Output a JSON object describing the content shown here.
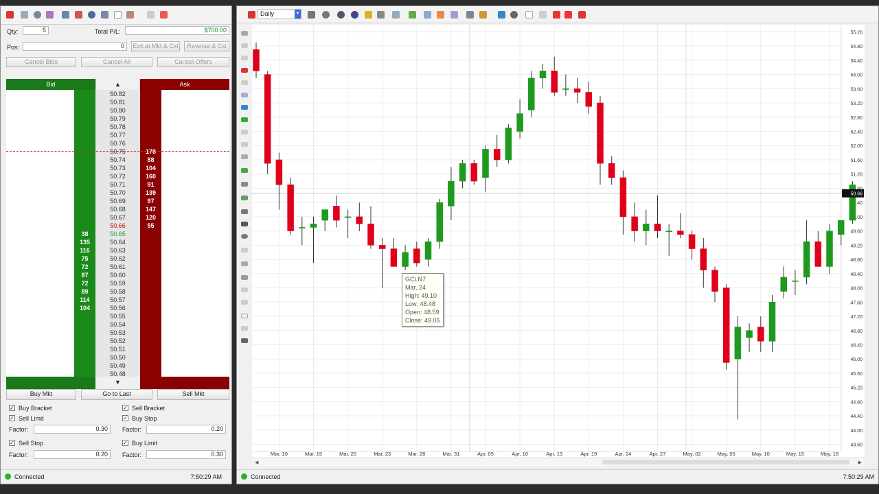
{
  "order_panel": {
    "qty_label": "Qty:",
    "qty_value": "5",
    "total_pl_label": "Total P/L:",
    "total_pl_value": "$700.00",
    "pos_label": "Pos:",
    "pos_value": "0",
    "exit_label": "Exit at Mkt & Cxl",
    "reverse_label": "Reverse & Cxl",
    "cancel_bids_label": "Cancel Bids",
    "cancel_all_label": "Cancel All",
    "cancel_offers_label": "Cancel Offers"
  },
  "ladder": {
    "bid_header": "Bid",
    "ask_header": "Ask",
    "last_price": "50.66",
    "rows": [
      {
        "price": "50.82",
        "bid": "",
        "ask": ""
      },
      {
        "price": "50.81",
        "bid": "",
        "ask": ""
      },
      {
        "price": "50.80",
        "bid": "",
        "ask": ""
      },
      {
        "price": "50.79",
        "bid": "",
        "ask": ""
      },
      {
        "price": "50.78",
        "bid": "",
        "ask": ""
      },
      {
        "price": "50.77",
        "bid": "",
        "ask": ""
      },
      {
        "price": "50.76",
        "bid": "",
        "ask": ""
      },
      {
        "price": "50.75",
        "bid": "",
        "ask": "178"
      },
      {
        "price": "50.74",
        "bid": "",
        "ask": "88"
      },
      {
        "price": "50.73",
        "bid": "",
        "ask": "104"
      },
      {
        "price": "50.72",
        "bid": "",
        "ask": "160"
      },
      {
        "price": "50.71",
        "bid": "",
        "ask": "91"
      },
      {
        "price": "50.70",
        "bid": "",
        "ask": "139"
      },
      {
        "price": "50.69",
        "bid": "",
        "ask": "97"
      },
      {
        "price": "50.68",
        "bid": "",
        "ask": "147"
      },
      {
        "price": "50.67",
        "bid": "",
        "ask": "120"
      },
      {
        "price": "50.66",
        "bid": "",
        "ask": "55"
      },
      {
        "price": "50.65",
        "bid": "38",
        "ask": ""
      },
      {
        "price": "50.64",
        "bid": "135",
        "ask": ""
      },
      {
        "price": "50.63",
        "bid": "116",
        "ask": ""
      },
      {
        "price": "50.62",
        "bid": "75",
        "ask": ""
      },
      {
        "price": "50.61",
        "bid": "72",
        "ask": ""
      },
      {
        "price": "50.60",
        "bid": "87",
        "ask": ""
      },
      {
        "price": "50.59",
        "bid": "72",
        "ask": ""
      },
      {
        "price": "50.58",
        "bid": "89",
        "ask": ""
      },
      {
        "price": "50.57",
        "bid": "114",
        "ask": ""
      },
      {
        "price": "50.56",
        "bid": "104",
        "ask": ""
      },
      {
        "price": "50.55",
        "bid": "",
        "ask": ""
      },
      {
        "price": "50.54",
        "bid": "",
        "ask": ""
      },
      {
        "price": "50.53",
        "bid": "",
        "ask": ""
      },
      {
        "price": "50.52",
        "bid": "",
        "ask": ""
      },
      {
        "price": "50.51",
        "bid": "",
        "ask": ""
      },
      {
        "price": "50.50",
        "bid": "",
        "ask": ""
      },
      {
        "price": "50.49",
        "bid": "",
        "ask": ""
      },
      {
        "price": "50.48",
        "bid": "",
        "ask": ""
      }
    ]
  },
  "actions": {
    "buy_mkt": "Buy Mkt",
    "go_to_last": "Go to Last",
    "sell_mkt": "Sell Mkt"
  },
  "brackets": {
    "buy_bracket": "Buy Bracket",
    "sell_bracket": "Sell Bracket",
    "sell_limit": "Sell Limit",
    "buy_stop": "Buy Stop",
    "sell_stop": "Sell Stop",
    "buy_limit": "Buy Limit",
    "factor_label": "Factor:",
    "sell_limit_factor": "0.30",
    "buy_stop_factor": "0.20",
    "sell_stop_factor": "0.20",
    "buy_limit_factor": "0.30"
  },
  "status": {
    "connected": "Connected",
    "time": "7:50:29 AM"
  },
  "chart_toolbar": {
    "timeframe": "Daily"
  },
  "tooltip": {
    "symbol": "GCLN7",
    "date": "Mar, 24",
    "high": "High: 49.10",
    "low": "Low: 48.48",
    "open": "Open: 48.59",
    "close": "Close: 49.05"
  },
  "chart_data": {
    "type": "candlestick",
    "symbol": "GCLN7",
    "ylim": [
      43.4,
      55.4
    ],
    "last_price_label": "50.66",
    "y_ticks": [
      "55.20",
      "54.80",
      "54.40",
      "54.00",
      "53.60",
      "53.20",
      "52.80",
      "52.40",
      "52.00",
      "51.60",
      "51.20",
      "50.80",
      "50.40",
      "50.00",
      "49.60",
      "49.20",
      "48.80",
      "48.40",
      "48.00",
      "47.60",
      "47.20",
      "46.80",
      "46.40",
      "46.00",
      "45.60",
      "45.20",
      "44.80",
      "44.40",
      "44.00",
      "43.60"
    ],
    "x_ticks": [
      "Mar, 10",
      "Mar, 15",
      "Mar, 20",
      "Mar, 23",
      "Mar, 28",
      "Mar, 31",
      "Apr, 05",
      "Apr, 10",
      "Apr, 13",
      "Apr, 19",
      "Apr, 24",
      "Apr, 27",
      "May, 02",
      "May, 05",
      "May, 10",
      "May, 15",
      "May, 18"
    ],
    "x_tick_bar_index": [
      2,
      5,
      8,
      11,
      14,
      17,
      20,
      23,
      26,
      29,
      32,
      35,
      38,
      41,
      44,
      47,
      50
    ],
    "candles": [
      {
        "o": 54.7,
        "h": 54.9,
        "l": 53.9,
        "c": 54.1
      },
      {
        "o": 54.0,
        "h": 54.1,
        "l": 51.2,
        "c": 51.5
      },
      {
        "o": 51.6,
        "h": 51.8,
        "l": 50.2,
        "c": 50.9
      },
      {
        "o": 50.9,
        "h": 51.1,
        "l": 49.5,
        "c": 49.6
      },
      {
        "o": 49.7,
        "h": 50.0,
        "l": 49.2,
        "c": 49.7
      },
      {
        "o": 49.7,
        "h": 50.0,
        "l": 48.7,
        "c": 49.8
      },
      {
        "o": 49.9,
        "h": 50.2,
        "l": 49.6,
        "c": 50.2
      },
      {
        "o": 50.3,
        "h": 50.6,
        "l": 49.7,
        "c": 49.9
      },
      {
        "o": 50.0,
        "h": 50.2,
        "l": 49.4,
        "c": 50.0
      },
      {
        "o": 50.0,
        "h": 50.4,
        "l": 49.6,
        "c": 49.8
      },
      {
        "o": 49.8,
        "h": 50.3,
        "l": 49.1,
        "c": 49.2
      },
      {
        "o": 49.2,
        "h": 49.4,
        "l": 48.0,
        "c": 49.1
      },
      {
        "o": 49.1,
        "h": 49.4,
        "l": 48.6,
        "c": 48.6
      },
      {
        "o": 48.6,
        "h": 49.2,
        "l": 48.5,
        "c": 49.0
      },
      {
        "o": 49.1,
        "h": 49.3,
        "l": 48.6,
        "c": 48.7
      },
      {
        "o": 48.8,
        "h": 49.4,
        "l": 48.6,
        "c": 49.3
      },
      {
        "o": 49.3,
        "h": 50.5,
        "l": 49.1,
        "c": 50.4
      },
      {
        "o": 50.3,
        "h": 51.4,
        "l": 49.9,
        "c": 51.0
      },
      {
        "o": 51.0,
        "h": 51.6,
        "l": 50.8,
        "c": 51.5
      },
      {
        "o": 51.5,
        "h": 51.6,
        "l": 50.9,
        "c": 51.0
      },
      {
        "o": 51.1,
        "h": 52.0,
        "l": 50.7,
        "c": 51.9
      },
      {
        "o": 51.9,
        "h": 52.3,
        "l": 51.4,
        "c": 51.6
      },
      {
        "o": 51.6,
        "h": 52.6,
        "l": 51.5,
        "c": 52.5
      },
      {
        "o": 52.4,
        "h": 53.3,
        "l": 52.2,
        "c": 52.9
      },
      {
        "o": 53.0,
        "h": 54.1,
        "l": 52.8,
        "c": 53.9
      },
      {
        "o": 53.9,
        "h": 54.3,
        "l": 53.6,
        "c": 54.1
      },
      {
        "o": 54.1,
        "h": 54.5,
        "l": 53.4,
        "c": 53.5
      },
      {
        "o": 53.6,
        "h": 54.0,
        "l": 53.4,
        "c": 53.6
      },
      {
        "o": 53.6,
        "h": 53.9,
        "l": 53.2,
        "c": 53.5
      },
      {
        "o": 53.5,
        "h": 53.8,
        "l": 52.9,
        "c": 53.1
      },
      {
        "o": 53.2,
        "h": 53.4,
        "l": 50.9,
        "c": 51.5
      },
      {
        "o": 51.5,
        "h": 51.7,
        "l": 50.9,
        "c": 51.1
      },
      {
        "o": 51.1,
        "h": 51.3,
        "l": 49.5,
        "c": 50.0
      },
      {
        "o": 50.0,
        "h": 50.4,
        "l": 49.3,
        "c": 49.6
      },
      {
        "o": 49.6,
        "h": 50.2,
        "l": 49.2,
        "c": 49.8
      },
      {
        "o": 49.8,
        "h": 50.6,
        "l": 49.4,
        "c": 49.6
      },
      {
        "o": 49.6,
        "h": 49.8,
        "l": 48.9,
        "c": 49.6
      },
      {
        "o": 49.6,
        "h": 50.1,
        "l": 49.4,
        "c": 49.5
      },
      {
        "o": 49.5,
        "h": 49.6,
        "l": 48.8,
        "c": 49.1
      },
      {
        "o": 49.1,
        "h": 49.4,
        "l": 48.0,
        "c": 48.5
      },
      {
        "o": 48.5,
        "h": 48.6,
        "l": 47.6,
        "c": 47.9
      },
      {
        "o": 48.0,
        "h": 48.1,
        "l": 45.7,
        "c": 45.9
      },
      {
        "o": 46.0,
        "h": 47.2,
        "l": 44.3,
        "c": 46.9
      },
      {
        "o": 46.6,
        "h": 47.0,
        "l": 46.2,
        "c": 46.8
      },
      {
        "o": 46.9,
        "h": 47.2,
        "l": 46.2,
        "c": 46.5
      },
      {
        "o": 46.5,
        "h": 47.8,
        "l": 46.2,
        "c": 47.6
      },
      {
        "o": 47.9,
        "h": 48.6,
        "l": 47.7,
        "c": 48.3
      },
      {
        "o": 48.2,
        "h": 48.5,
        "l": 47.8,
        "c": 48.2
      },
      {
        "o": 48.3,
        "h": 49.9,
        "l": 48.1,
        "c": 49.3
      },
      {
        "o": 49.3,
        "h": 49.6,
        "l": 48.6,
        "c": 48.6
      },
      {
        "o": 48.6,
        "h": 49.8,
        "l": 48.4,
        "c": 49.6
      },
      {
        "o": 49.5,
        "h": 49.9,
        "l": 49.2,
        "c": 49.9
      },
      {
        "o": 49.9,
        "h": 51.0,
        "l": 49.8,
        "c": 50.9
      }
    ]
  }
}
